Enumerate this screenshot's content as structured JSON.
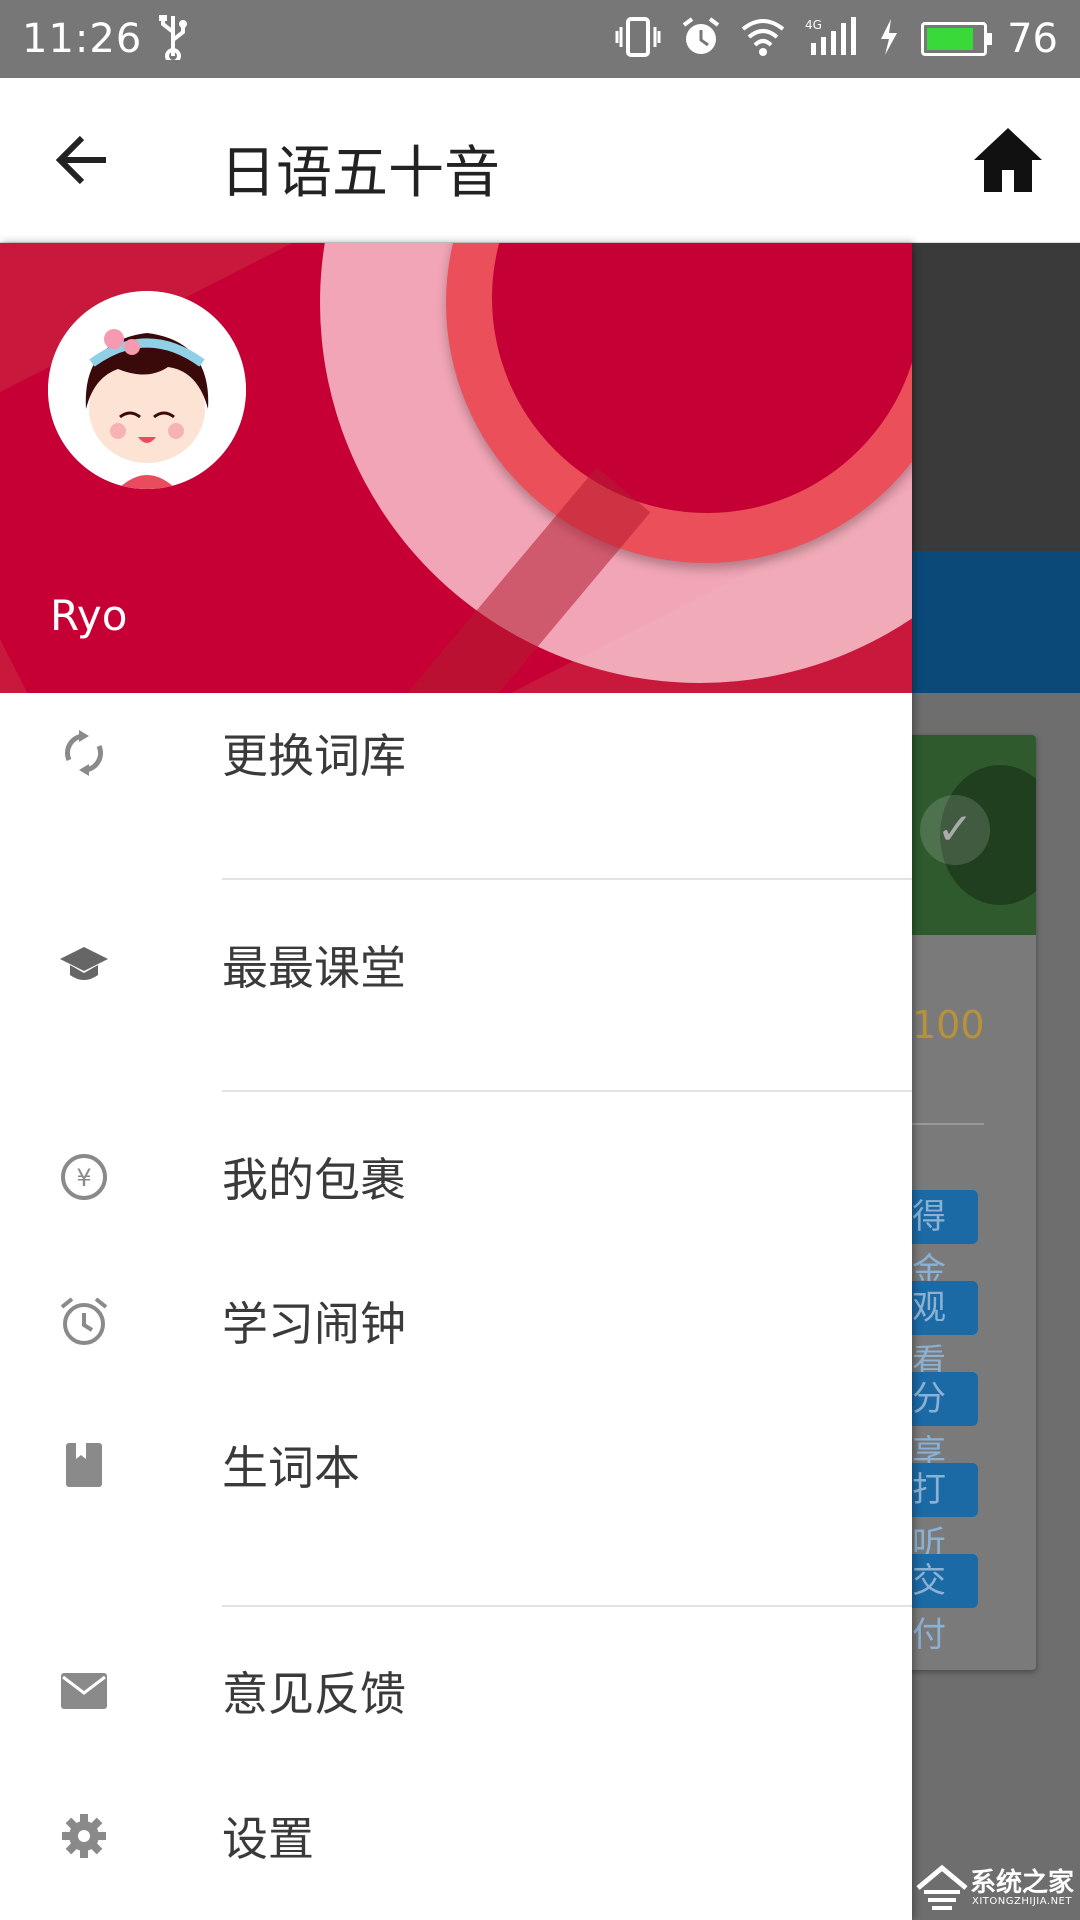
{
  "status_bar": {
    "time": "11:26",
    "battery": "76",
    "network": "4G"
  },
  "app_bar": {
    "title": "日语五十音"
  },
  "drawer": {
    "user_name": "Ryo",
    "items": [
      {
        "label": "更换词库",
        "icon": "sync-icon"
      },
      {
        "label": "最最课堂",
        "icon": "school-icon"
      },
      {
        "label": "我的包裹",
        "icon": "yen-coin-icon"
      },
      {
        "label": "学习闹钟",
        "icon": "alarm-clock-icon"
      },
      {
        "label": "生词本",
        "icon": "book-icon"
      },
      {
        "label": "意见反馈",
        "icon": "mail-icon"
      },
      {
        "label": "设置",
        "icon": "settings-gear-icon"
      }
    ]
  },
  "background": {
    "score": "100",
    "tags": [
      "得金",
      "观看",
      "分享",
      "打听",
      "交付"
    ]
  },
  "watermark": {
    "text": "系统之家",
    "sub": "XITONGZHIJIA.NET"
  },
  "colors": {
    "header_red": "#c8193d",
    "icon_gray": "#888888",
    "text": "#3a3a3a"
  }
}
